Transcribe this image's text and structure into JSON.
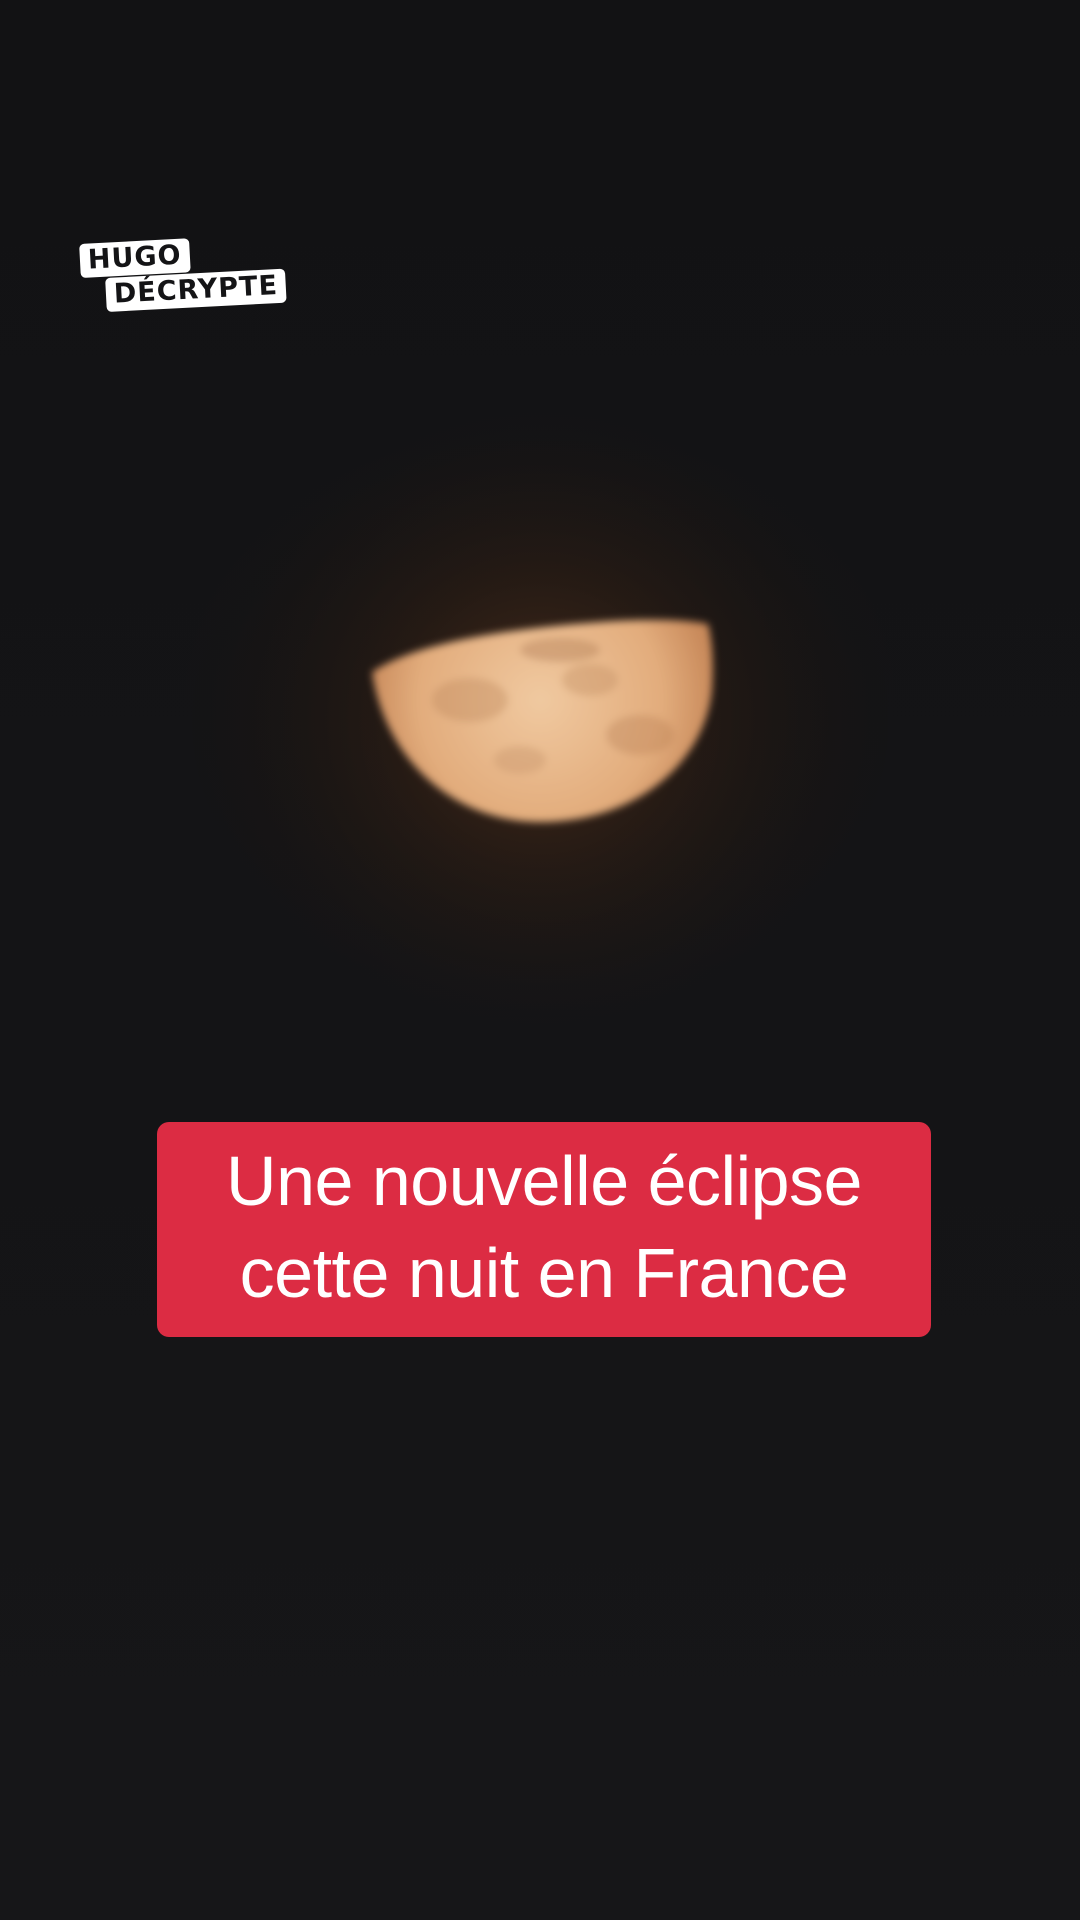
{
  "logo": {
    "line1": "HUGO",
    "line2": "DÉCRYPTE"
  },
  "caption": {
    "line1": "Une nouvelle éclipse",
    "line2": "cette nuit en France"
  },
  "colors": {
    "background": "#141416",
    "caption_background": "#dc2c43",
    "caption_text": "#ffffff",
    "moon": "#e9b98c"
  }
}
